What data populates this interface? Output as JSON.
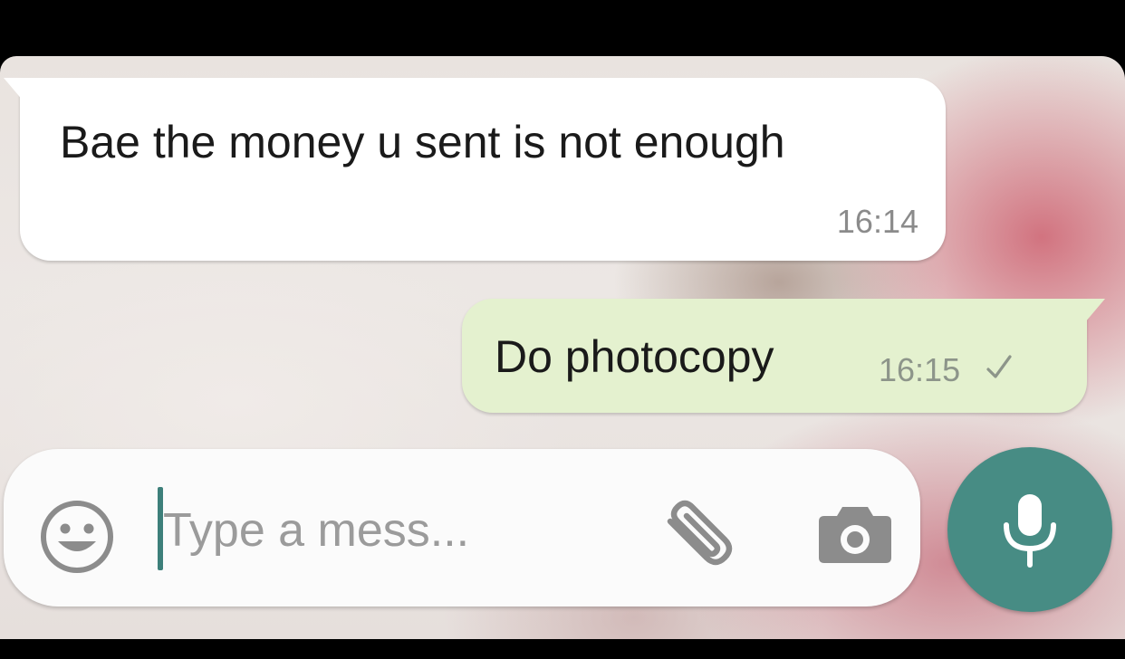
{
  "messages": [
    {
      "direction": "incoming",
      "text": "Bae the money u sent is not enough",
      "time": "16:14"
    },
    {
      "direction": "outgoing",
      "text": "Do photocopy",
      "time": "16:15",
      "status_icon": "single-check-icon"
    }
  ],
  "composer": {
    "placeholder": "Type a mess...",
    "emoji_icon": "smiley-icon",
    "attach_icon": "paperclip-icon",
    "camera_icon": "camera-icon",
    "send_icon": "microphone-icon"
  },
  "colors": {
    "incoming_bubble": "#ffffff",
    "outgoing_bubble": "#e4f1cf",
    "mic_button": "#478c84",
    "cursor": "#3d7f7a"
  }
}
